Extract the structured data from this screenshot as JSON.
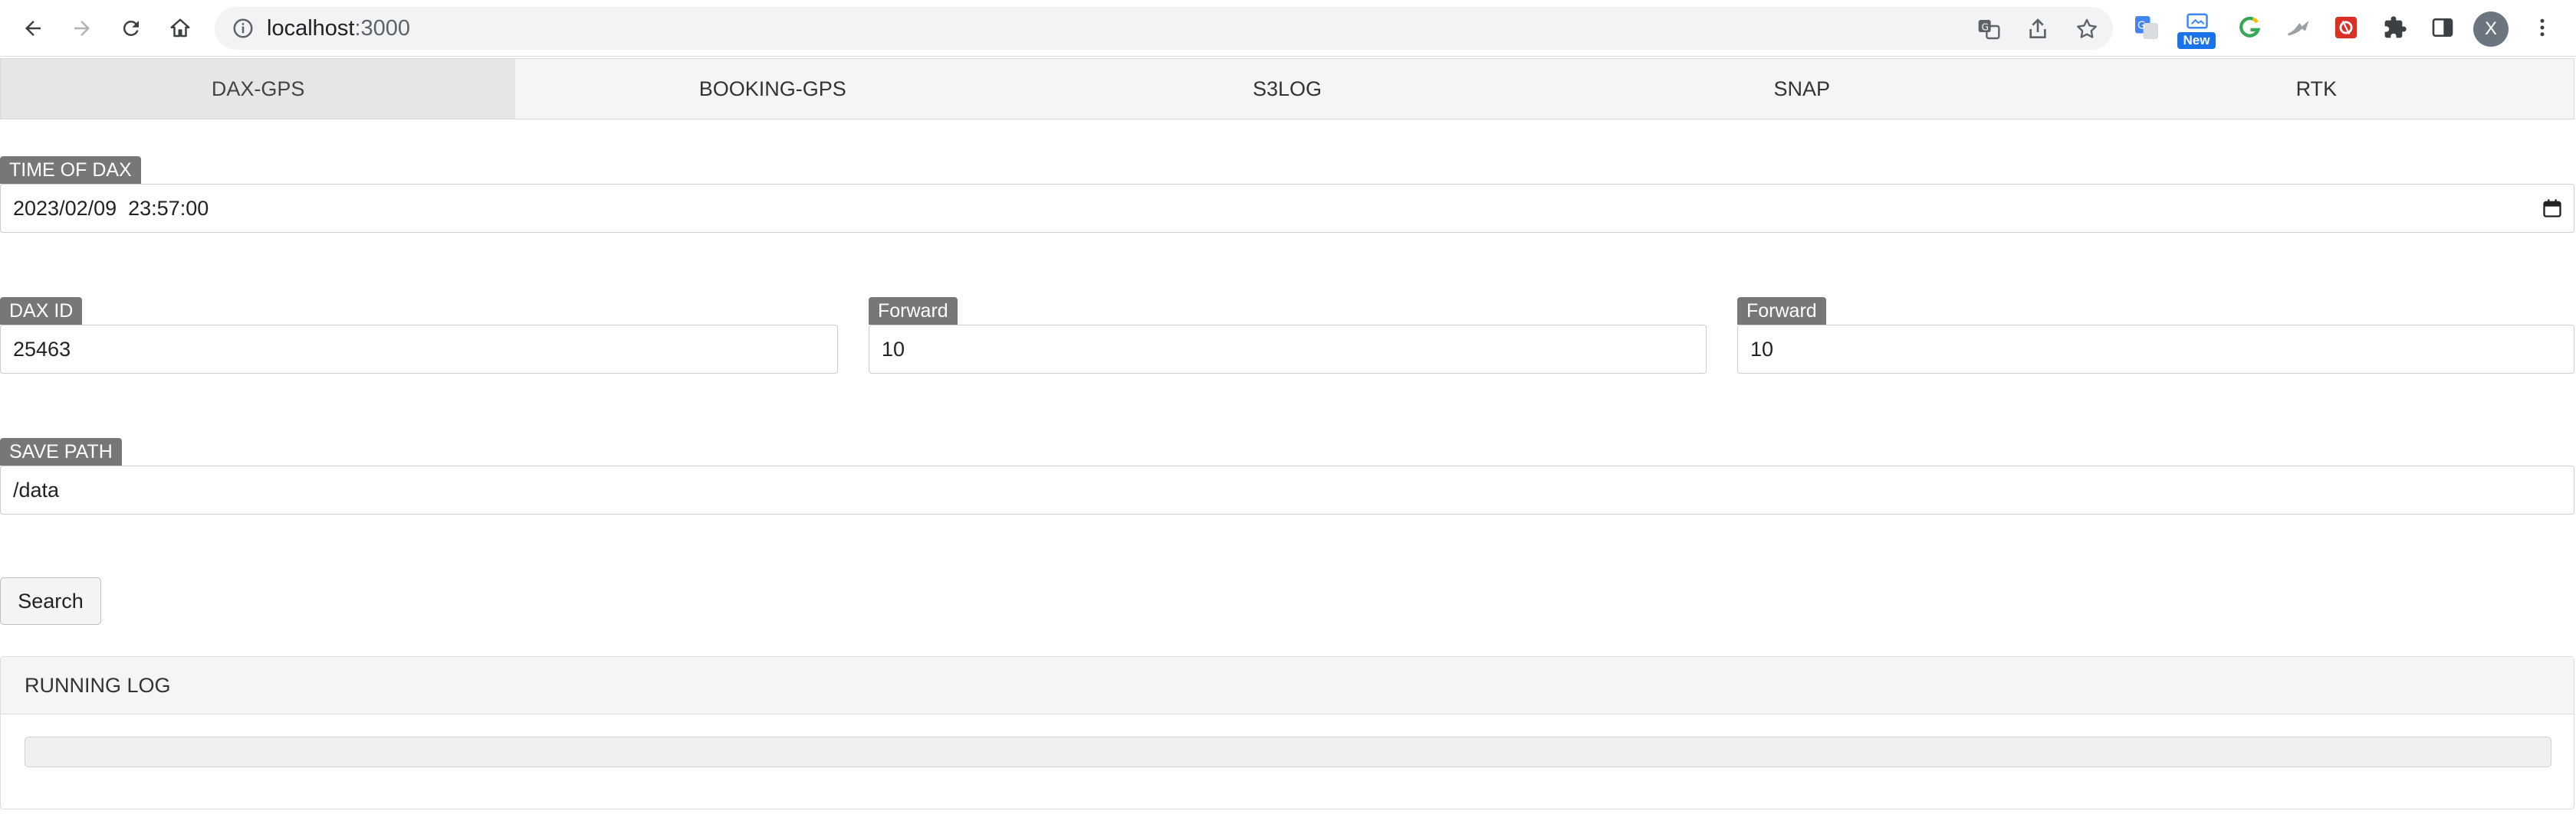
{
  "browser": {
    "url_host": "localhost",
    "url_port": ":3000",
    "new_badge": "New",
    "profile_initial": "X",
    "icons": [
      "back-arrow-icon",
      "forward-arrow-icon",
      "reload-icon",
      "home-icon",
      "info-icon",
      "translate-icon",
      "share-icon",
      "bookmark-star-icon",
      "extensions-puzzle-icon",
      "side-panel-icon",
      "kebab-menu-icon"
    ]
  },
  "tabs": [
    {
      "label": "DAX-GPS",
      "active": true
    },
    {
      "label": "BOOKING-GPS",
      "active": false
    },
    {
      "label": "S3LOG",
      "active": false
    },
    {
      "label": "SNAP",
      "active": false
    },
    {
      "label": "RTK",
      "active": false
    }
  ],
  "form": {
    "time_label": "TIME OF DAX",
    "time_value": "2023/02/09  23:57:00",
    "dax_id_label": "DAX ID",
    "dax_id_value": "25463",
    "forward1_label": "Forward",
    "forward1_value": "10",
    "forward2_label": "Forward",
    "forward2_value": "10",
    "save_path_label": "SAVE PATH",
    "save_path_value": "/data",
    "search_label": "Search"
  },
  "log": {
    "title": "RUNNING LOG"
  },
  "colors": {
    "label_bg": "#777777",
    "tab_active_bg": "#e6e6e6",
    "omnibox_bg": "#f1f3f4"
  }
}
